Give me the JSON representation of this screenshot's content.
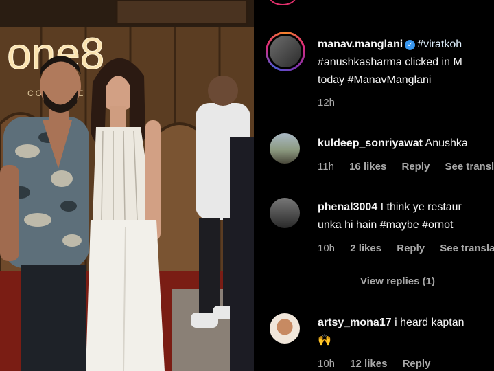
{
  "post": {
    "author": "manav.manglani",
    "caption_line1": "#viratkoh",
    "caption_line2": "#anushkasharma clicked in M",
    "caption_line3": "today #ManavManglani",
    "time": "12h",
    "sign_text": "one8",
    "sign_sub": "COMMUNE"
  },
  "comments": [
    {
      "user": "kuldeep_sonriyawat",
      "text": "Anushka",
      "time": "11h",
      "likes": "16 likes",
      "reply": "Reply",
      "translate": "See transla"
    },
    {
      "user": "phenal3004",
      "text": "I think ye restaur",
      "text_line2": "unka hi hain #maybe #ornot",
      "time": "10h",
      "likes": "2 likes",
      "reply": "Reply",
      "translate": "See translat",
      "view_replies": "View replies (1)"
    },
    {
      "user": "artsy_mona17",
      "text": "i heard kaptan",
      "text_line2": "🙌",
      "time": "10h",
      "likes": "12 likes",
      "reply": "Reply"
    }
  ],
  "colors": {
    "background": "#000000",
    "secondary_text": "#a8a8a8",
    "verified": "#3897f0"
  }
}
